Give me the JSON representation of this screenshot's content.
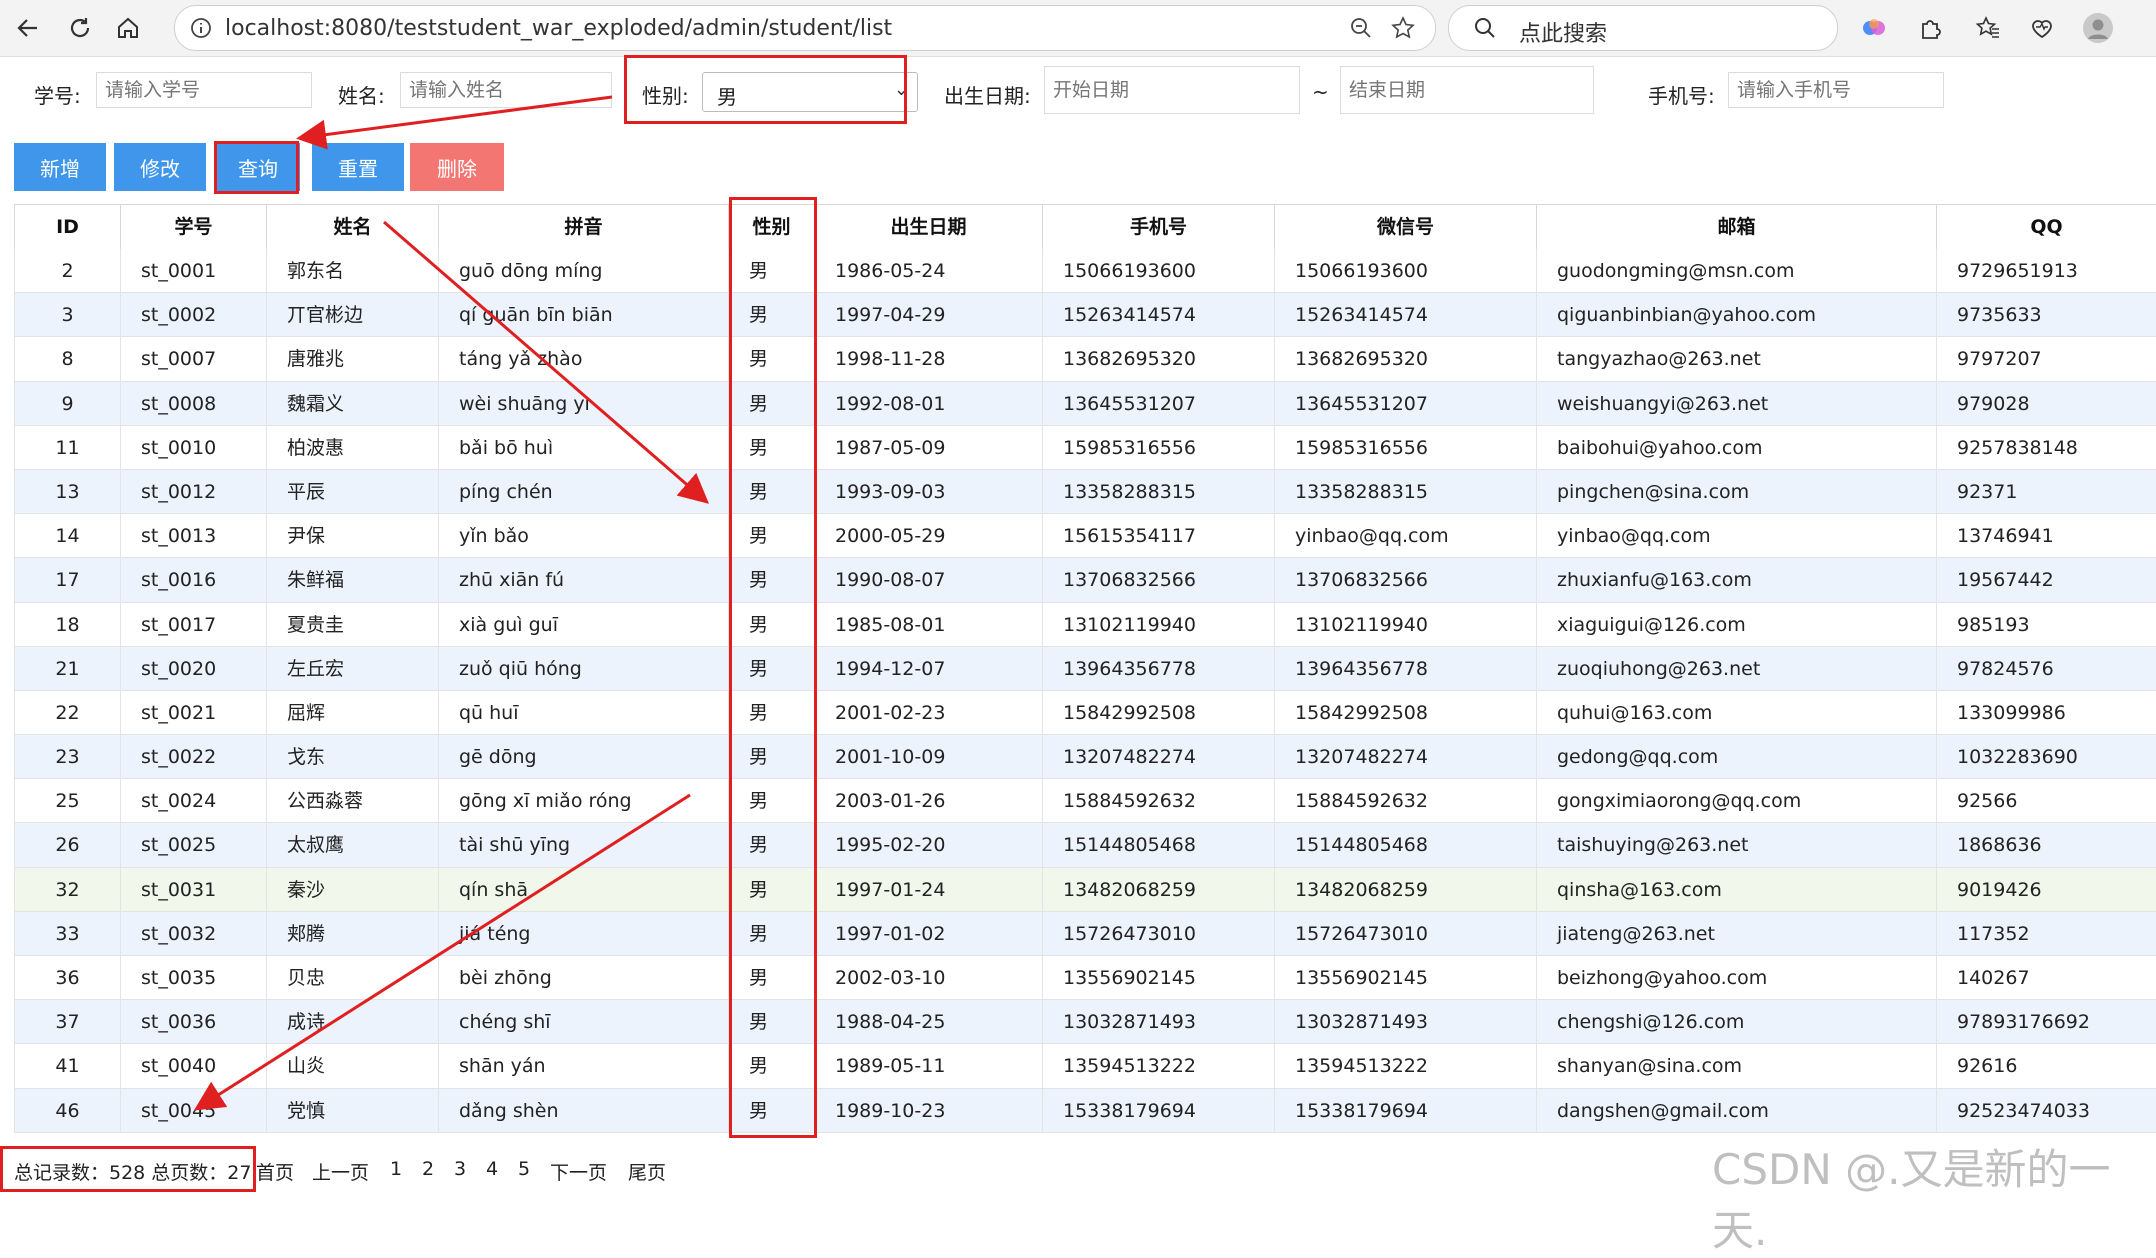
{
  "browser": {
    "url": "localhost:8080/teststudent_war_exploded/admin/student/list",
    "search_placeholder": "点此搜索"
  },
  "filters": {
    "student_no_label": "学号:",
    "student_no_placeholder": "请输入学号",
    "name_label": "姓名:",
    "name_placeholder": "请输入姓名",
    "gender_label": "性别:",
    "gender_value": "男",
    "birth_label": "出生日期:",
    "birth_start_placeholder": "开始日期",
    "range_sep": "~",
    "birth_end_placeholder": "结束日期",
    "phone_label": "手机号:",
    "phone_placeholder": "请输入手机号"
  },
  "actions": {
    "add": "新增",
    "edit": "修改",
    "query": "查询",
    "reset": "重置",
    "delete": "删除"
  },
  "table": {
    "headers": [
      "ID",
      "学号",
      "姓名",
      "拼音",
      "性别",
      "出生日期",
      "手机号",
      "微信号",
      "邮箱",
      "QQ"
    ],
    "rows": [
      [
        "2",
        "st_0001",
        "郭东名",
        "guō dōng míng",
        "男",
        "1986-05-24",
        "15066193600",
        "15066193600",
        "guodongming@msn.com",
        "9729651913"
      ],
      [
        "3",
        "st_0002",
        "丌官彬边",
        "qí guān bīn biān",
        "男",
        "1997-04-29",
        "15263414574",
        "15263414574",
        "qiguanbinbian@yahoo.com",
        "9735633"
      ],
      [
        "8",
        "st_0007",
        "唐雅兆",
        "táng yǎ zhào",
        "男",
        "1998-11-28",
        "13682695320",
        "13682695320",
        "tangyazhao@263.net",
        "9797207"
      ],
      [
        "9",
        "st_0008",
        "魏霜义",
        "wèi shuāng yì",
        "男",
        "1992-08-01",
        "13645531207",
        "13645531207",
        "weishuangyi@263.net",
        "979028"
      ],
      [
        "11",
        "st_0010",
        "柏波惠",
        "bǎi bō huì",
        "男",
        "1987-05-09",
        "15985316556",
        "15985316556",
        "baibohui@yahoo.com",
        "9257838148"
      ],
      [
        "13",
        "st_0012",
        "平辰",
        "píng chén",
        "男",
        "1993-09-03",
        "13358288315",
        "13358288315",
        "pingchen@sina.com",
        "92371"
      ],
      [
        "14",
        "st_0013",
        "尹保",
        "yǐn bǎo",
        "男",
        "2000-05-29",
        "15615354117",
        "yinbao@qq.com",
        "yinbao@qq.com",
        "13746941"
      ],
      [
        "17",
        "st_0016",
        "朱鲜福",
        "zhū xiān fú",
        "男",
        "1990-08-07",
        "13706832566",
        "13706832566",
        "zhuxianfu@163.com",
        "19567442"
      ],
      [
        "18",
        "st_0017",
        "夏贵圭",
        "xià guì guī",
        "男",
        "1985-08-01",
        "13102119940",
        "13102119940",
        "xiaguigui@126.com",
        "985193"
      ],
      [
        "21",
        "st_0020",
        "左丘宏",
        "zuǒ qiū hóng",
        "男",
        "1994-12-07",
        "13964356778",
        "13964356778",
        "zuoqiuhong@263.net",
        "97824576"
      ],
      [
        "22",
        "st_0021",
        "屈辉",
        "qū huī",
        "男",
        "2001-02-23",
        "15842992508",
        "15842992508",
        "quhui@163.com",
        "133099986"
      ],
      [
        "23",
        "st_0022",
        "戈东",
        "gē dōng",
        "男",
        "2001-10-09",
        "13207482274",
        "13207482274",
        "gedong@qq.com",
        "1032283690"
      ],
      [
        "25",
        "st_0024",
        "公西淼蓉",
        "gōng xī miǎo róng",
        "男",
        "2003-01-26",
        "15884592632",
        "15884592632",
        "gongximiaorong@qq.com",
        "92566"
      ],
      [
        "26",
        "st_0025",
        "太叔鹰",
        "tài shū yīng",
        "男",
        "1995-02-20",
        "15144805468",
        "15144805468",
        "taishuying@263.net",
        "1868636"
      ],
      [
        "32",
        "st_0031",
        "秦沙",
        "qín shā",
        "男",
        "1997-01-24",
        "13482068259",
        "13482068259",
        "qinsha@163.com",
        "9019426"
      ],
      [
        "33",
        "st_0032",
        "郏腾",
        "jiá téng",
        "男",
        "1997-01-02",
        "15726473010",
        "15726473010",
        "jiateng@263.net",
        "117352"
      ],
      [
        "36",
        "st_0035",
        "贝忠",
        "bèi zhōng",
        "男",
        "2002-03-10",
        "13556902145",
        "13556902145",
        "beizhong@yahoo.com",
        "140267"
      ],
      [
        "37",
        "st_0036",
        "成诗",
        "chéng shī",
        "男",
        "1988-04-25",
        "13032871493",
        "13032871493",
        "chengshi@126.com",
        "97893176692"
      ],
      [
        "41",
        "st_0040",
        "山炎",
        "shān yán",
        "男",
        "1989-05-11",
        "13594513222",
        "13594513222",
        "shanyan@sina.com",
        "92616"
      ],
      [
        "46",
        "st_0045",
        "党慎",
        "dǎng shèn",
        "男",
        "1989-10-23",
        "15338179694",
        "15338179694",
        "dangshen@gmail.com",
        "92523474033"
      ]
    ]
  },
  "pager": {
    "summary": "总记录数：528 总页数：27",
    "first": "首页",
    "prev": "上一页",
    "pages": [
      "1",
      "2",
      "3",
      "4",
      "5"
    ],
    "next": "下一页",
    "last": "尾页"
  },
  "watermark": "CSDN @.又是新的一天.",
  "colors": {
    "button_blue": "#3f96ea",
    "button_red": "#f37672",
    "annotation_red": "#e02020",
    "row_stripe": "#edf3fc"
  },
  "icons": [
    "back-icon",
    "refresh-icon",
    "home-icon",
    "info-icon",
    "zoom-icon",
    "favorite-star-icon",
    "search-icon",
    "copilot-icon",
    "extensions-icon",
    "favorites-icon",
    "collections-icon",
    "profile-avatar-icon"
  ]
}
